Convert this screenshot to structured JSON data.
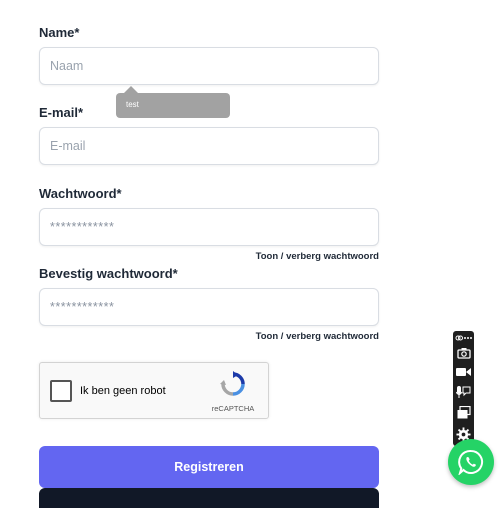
{
  "form": {
    "name_label": "Name*",
    "name_placeholder": "Naam",
    "email_label": "E-mail*",
    "email_placeholder": "E-mail",
    "password_label": "Wachtwoord*",
    "password_placeholder": "************",
    "password_toggle": "Toon / verberg wachtwoord",
    "confirm_label": "Bevestig wachtwoord*",
    "confirm_placeholder": "************",
    "confirm_toggle": "Toon / verberg wachtwoord",
    "submit_label": "Registreren"
  },
  "tooltip": {
    "text": "test"
  },
  "captcha": {
    "label": "Ik ben geen robot",
    "brand": "reCAPTCHA",
    "checked": false
  },
  "toolbar": {
    "icons": [
      "link-icon",
      "more-icon",
      "camera-icon",
      "video-icon",
      "mic-chat-icon",
      "windows-icon",
      "gear-icon"
    ]
  },
  "whatsapp": {
    "icon": "whatsapp-icon"
  },
  "colors": {
    "primary": "#6366f1",
    "whatsapp": "#25d366",
    "dark": "#111827"
  }
}
